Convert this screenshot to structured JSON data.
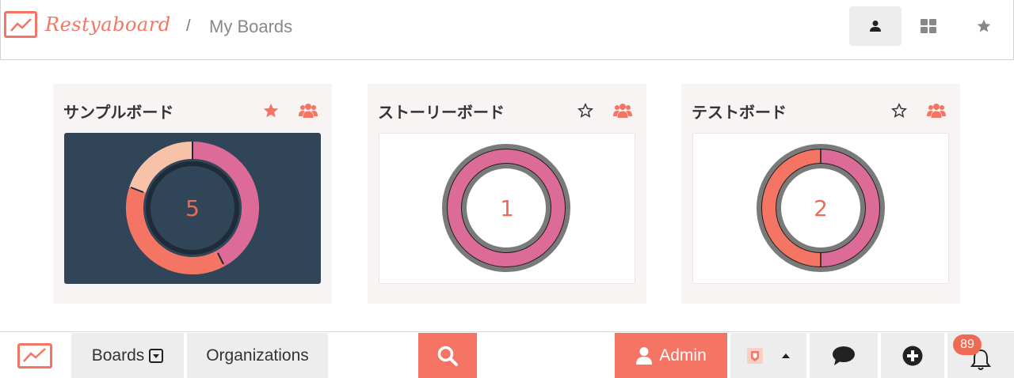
{
  "header": {
    "logo_text": "Restyaboard",
    "breadcrumb_separator": "/",
    "breadcrumb": "My Boards"
  },
  "boards": [
    {
      "title": "サンプルボード",
      "starred": true,
      "count": "5",
      "dark": true
    },
    {
      "title": "ストーリーボード",
      "starred": false,
      "count": "1",
      "dark": false
    },
    {
      "title": "テストボード",
      "starred": false,
      "count": "2",
      "dark": false
    }
  ],
  "footer": {
    "boards_label": "Boards",
    "organizations_label": "Organizations",
    "admin_label": "Admin",
    "notification_count": "89"
  },
  "colors": {
    "accent": "#f47564",
    "pink": "#dc6b98",
    "peach": "#f8c2a8",
    "dark_card": "#314558"
  },
  "icons": [
    "logo-icon",
    "user-icon",
    "grid-icon",
    "star-icon",
    "users-icon",
    "search-icon",
    "chevron-up-icon",
    "chat-icon",
    "plus-circle-icon",
    "bell-icon",
    "square-caret-down-icon"
  ]
}
